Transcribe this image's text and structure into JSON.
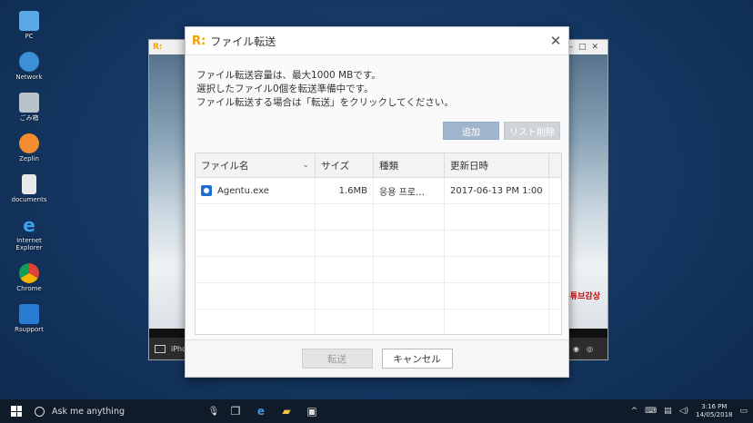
{
  "desktop": {
    "icons": [
      {
        "label": "PC"
      },
      {
        "label": "Network"
      },
      {
        "label": "ごみ箱"
      },
      {
        "label": "Zeplin"
      },
      {
        "label": "documents"
      },
      {
        "label": "Internet Explorer"
      },
      {
        "label": "Chrome"
      },
      {
        "label": "Rsupport"
      }
    ]
  },
  "remote_window": {
    "device_label": "iPhone",
    "red_text": "유튜브감상"
  },
  "dialog": {
    "logo": "R:",
    "title": "ファイル転送",
    "close_glyph": "✕",
    "messages": [
      "ファイル転送容量は、最大1000 MBです。",
      "選択したファイル0個を転送準備中です。",
      "ファイル転送する場合は「転送」をクリックしてください。"
    ],
    "add_button": "追加",
    "delete_button": "リスト削除",
    "table": {
      "headers": [
        "ファイル名",
        "サイズ",
        "種類",
        "更新日時"
      ],
      "rows": [
        {
          "name": "Agentu.exe",
          "size": "1.6MB",
          "type": "응용 프로…",
          "modified": "2017-06-13 PM 1:00"
        }
      ]
    },
    "transfer_button": "転送",
    "cancel_button": "キャンセル"
  },
  "taskbar": {
    "search_placeholder": "Ask me anything",
    "time": "3:16 PM",
    "date": "14/05/2018"
  },
  "colors": {
    "accent": "#9fb6ce",
    "brand": "#f0a000"
  }
}
